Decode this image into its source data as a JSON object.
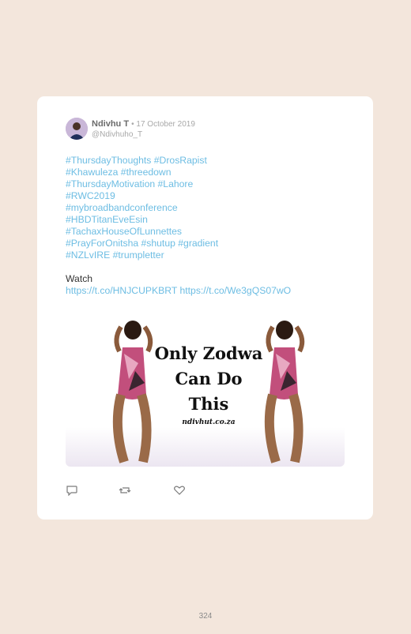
{
  "tweet": {
    "name": "Ndivhu T",
    "date": "• 17 October 2019",
    "handle": "@Ndivhuho_T",
    "hashtag_lines": [
      "#ThursdayThoughts #DrosRapist",
      "#Khawuleza #threedown",
      "#ThursdayMotivation #Lahore",
      "#RWC2019",
      "#mybroadbandconference",
      "#HBDTitanEveEsin",
      "#TachaxHouseOfLunnettes",
      "#PrayForOnitsha #shutup #gradient",
      "#NZLvIRE #trumpletter"
    ],
    "watch": "Watch",
    "links": "https://t.co/HNJCUPKBRT https://t.co/We3gQS07wO",
    "image": {
      "headline_lines": [
        "Only Zodwa",
        "Can Do",
        "This"
      ],
      "site": "ndivhut.co.za"
    }
  },
  "icons": [
    "reply-icon",
    "retweet-icon",
    "like-icon"
  ],
  "colors": {
    "background": "#f3e6dc",
    "link": "#6dbde3",
    "card": "#ffffff"
  },
  "page_number": "324"
}
